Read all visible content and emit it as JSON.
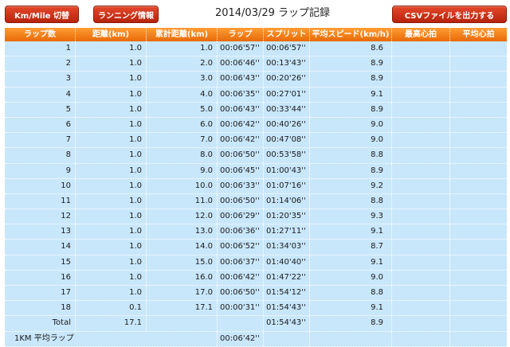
{
  "toolbar": {
    "km_mile_label": "Km/Mile 切替",
    "running_info_label": "ランニング情報",
    "csv_label": "CSVファイルを出力する"
  },
  "title": "2014/03/29 ラップ記録",
  "headers": [
    "ラップ数",
    "距離(km)",
    "累計距離(km)",
    "ラップ",
    "スプリット",
    "平均スピード(km/h)",
    "最高心拍",
    "平均心拍"
  ],
  "laps": [
    {
      "lap": "1",
      "dist": "1.0",
      "cum": "1.0",
      "time": "00:06'57''",
      "split": "00:06'57''",
      "speed": "8.6",
      "max_hr": "",
      "avg_hr": ""
    },
    {
      "lap": "2",
      "dist": "1.0",
      "cum": "2.0",
      "time": "00:06'46''",
      "split": "00:13'43''",
      "speed": "8.9",
      "max_hr": "",
      "avg_hr": ""
    },
    {
      "lap": "3",
      "dist": "1.0",
      "cum": "3.0",
      "time": "00:06'43''",
      "split": "00:20'26''",
      "speed": "8.9",
      "max_hr": "",
      "avg_hr": ""
    },
    {
      "lap": "4",
      "dist": "1.0",
      "cum": "4.0",
      "time": "00:06'35''",
      "split": "00:27'01''",
      "speed": "9.1",
      "max_hr": "",
      "avg_hr": ""
    },
    {
      "lap": "5",
      "dist": "1.0",
      "cum": "5.0",
      "time": "00:06'43''",
      "split": "00:33'44''",
      "speed": "8.9",
      "max_hr": "",
      "avg_hr": ""
    },
    {
      "lap": "6",
      "dist": "1.0",
      "cum": "6.0",
      "time": "00:06'42''",
      "split": "00:40'26''",
      "speed": "9.0",
      "max_hr": "",
      "avg_hr": ""
    },
    {
      "lap": "7",
      "dist": "1.0",
      "cum": "7.0",
      "time": "00:06'42''",
      "split": "00:47'08''",
      "speed": "9.0",
      "max_hr": "",
      "avg_hr": ""
    },
    {
      "lap": "8",
      "dist": "1.0",
      "cum": "8.0",
      "time": "00:06'50''",
      "split": "00:53'58''",
      "speed": "8.8",
      "max_hr": "",
      "avg_hr": ""
    },
    {
      "lap": "9",
      "dist": "1.0",
      "cum": "9.0",
      "time": "00:06'45''",
      "split": "01:00'43''",
      "speed": "8.9",
      "max_hr": "",
      "avg_hr": ""
    },
    {
      "lap": "10",
      "dist": "1.0",
      "cum": "10.0",
      "time": "00:06'33''",
      "split": "01:07'16''",
      "speed": "9.2",
      "max_hr": "",
      "avg_hr": ""
    },
    {
      "lap": "11",
      "dist": "1.0",
      "cum": "11.0",
      "time": "00:06'50''",
      "split": "01:14'06''",
      "speed": "8.8",
      "max_hr": "",
      "avg_hr": ""
    },
    {
      "lap": "12",
      "dist": "1.0",
      "cum": "12.0",
      "time": "00:06'29''",
      "split": "01:20'35''",
      "speed": "9.3",
      "max_hr": "",
      "avg_hr": ""
    },
    {
      "lap": "13",
      "dist": "1.0",
      "cum": "13.0",
      "time": "00:06'36''",
      "split": "01:27'11''",
      "speed": "9.1",
      "max_hr": "",
      "avg_hr": ""
    },
    {
      "lap": "14",
      "dist": "1.0",
      "cum": "14.0",
      "time": "00:06'52''",
      "split": "01:34'03''",
      "speed": "8.7",
      "max_hr": "",
      "avg_hr": ""
    },
    {
      "lap": "15",
      "dist": "1.0",
      "cum": "15.0",
      "time": "00:06'37''",
      "split": "01:40'40''",
      "speed": "9.1",
      "max_hr": "",
      "avg_hr": ""
    },
    {
      "lap": "16",
      "dist": "1.0",
      "cum": "16.0",
      "time": "00:06'42''",
      "split": "01:47'22''",
      "speed": "9.0",
      "max_hr": "",
      "avg_hr": ""
    },
    {
      "lap": "17",
      "dist": "1.0",
      "cum": "17.0",
      "time": "00:06'50''",
      "split": "01:54'12''",
      "speed": "8.8",
      "max_hr": "",
      "avg_hr": ""
    },
    {
      "lap": "18",
      "dist": "0.1",
      "cum": "17.1",
      "time": "00:00'31''",
      "split": "01:54'43''",
      "speed": "9.1",
      "max_hr": "",
      "avg_hr": ""
    }
  ],
  "total": {
    "label": "Total",
    "dist": "17.1",
    "cum": "",
    "time": "",
    "split": "01:54'43''",
    "speed": "8.9",
    "max_hr": "",
    "avg_hr": ""
  },
  "avg_lap": {
    "label": "1KM 平均ラップ",
    "time": "00:06'42''"
  },
  "colors": {
    "button_red": "#c8321a",
    "header_orange": "#f5821f",
    "row_blue": "#c9e7fb"
  }
}
